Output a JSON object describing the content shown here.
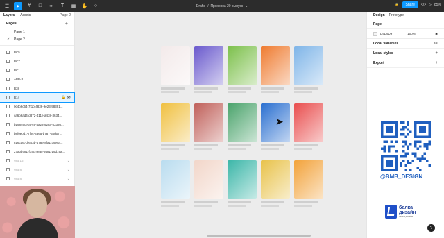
{
  "toolbar": {
    "tools": [
      {
        "icon": "figma-menu-icon"
      },
      {
        "icon": "move-tool-icon"
      },
      {
        "icon": "frame-tool-icon"
      },
      {
        "icon": "shape-tool-icon"
      },
      {
        "icon": "pen-tool-icon"
      },
      {
        "icon": "text-tool-icon"
      },
      {
        "icon": "resources-icon"
      },
      {
        "icon": "hand-tool-icon"
      },
      {
        "icon": "comment-tool-icon"
      }
    ],
    "breadcrumb_folder": "Drafts",
    "breadcrumb_sep": "/",
    "file_name": "Прохорка 20 выпуск",
    "share_label": "Share",
    "code_chip": "</>",
    "zoom": "85%",
    "accent": "#0d99ff"
  },
  "left_panel": {
    "tabs": [
      "Layers",
      "Assets"
    ],
    "page_dropdown": "Page 2",
    "pages_title": "Pages",
    "pages": [
      {
        "label": "Page 1",
        "current": false
      },
      {
        "label": "Page 2",
        "current": true
      }
    ],
    "layers": [
      {
        "label": "BC5",
        "selected": false
      },
      {
        "label": "BC7",
        "selected": false
      },
      {
        "label": "BC1",
        "selected": false
      },
      {
        "label": "АВВ-3",
        "selected": false
      },
      {
        "label": "В38",
        "selected": false
      },
      {
        "label": "В14",
        "selected": true
      },
      {
        "label": "0c4b6c64-7f1b-4836-9e23-98391...",
        "selected": false
      },
      {
        "label": "ca6b6ad4-d872-411e-a438-3634...",
        "selected": false
      },
      {
        "label": "b1984ece-a7c9-4a28-928a-53386...",
        "selected": false
      },
      {
        "label": "b8f0ebd1-7f8c-4365-b787-5bd07...",
        "selected": false
      },
      {
        "label": "816ca67d-6b3b-478e-8fa1-39eca...",
        "selected": false
      },
      {
        "label": "27a0b781-f14c-4ea5-9481-19d19a...",
        "selected": false
      },
      {
        "label": "WB 16",
        "selected": false
      },
      {
        "label": "WB 8",
        "selected": false
      },
      {
        "label": "WB 8",
        "selected": false
      }
    ]
  },
  "right_panel": {
    "tabs": [
      "Design",
      "Prototype"
    ],
    "page_title": "Page",
    "page_color_hex": "D9D9D9",
    "page_color_opacity": "100%",
    "sections": [
      "Local variables",
      "Local styles",
      "Export"
    ]
  },
  "canvas": {
    "card_colors": [
      [
        "#f3eaea",
        "#6a5acd",
        "#7cc04b",
        "#ef7b30",
        "#7fb5e8"
      ],
      [
        "#f0c040",
        "#c0605a",
        "#4aa36b",
        "#2a6fd0",
        "#e94e4e"
      ],
      [
        "#b9dcef",
        "#f2d6c9",
        "#3bb6a8",
        "#e8c24a",
        "#f2a23a"
      ]
    ]
  },
  "branding": {
    "social_handle": "@BMB_DESIGN",
    "logo_line1": "белка",
    "logo_line2": "дизайн",
    "logo_sub": "школа дизайна",
    "brand_color": "#1f5fbf"
  },
  "help_label": "?"
}
